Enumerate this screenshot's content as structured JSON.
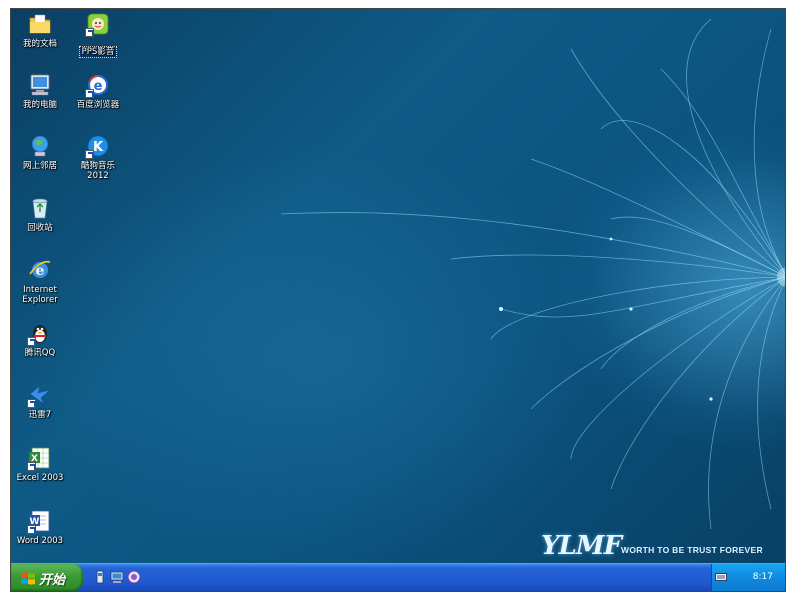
{
  "desktop": {
    "icons": [
      {
        "label": "我的文档"
      },
      {
        "label": "PPS影音"
      },
      {
        "label": "我的电脑"
      },
      {
        "label": "百度浏览器"
      },
      {
        "label": "网上邻居"
      },
      {
        "label": "酷狗音乐\n2012"
      },
      {
        "label": "回收站"
      },
      {
        "label": "Internet\nExplorer"
      },
      {
        "label": "腾讯QQ"
      },
      {
        "label": "迅雷7"
      },
      {
        "label": "Excel 2003"
      },
      {
        "label": "Word 2003"
      }
    ],
    "wallpaper": {
      "logo_text": "YLMF",
      "tagline": "WORTH TO BE TRUST FOREVER",
      "accent_color": "#8fdcff"
    }
  },
  "taskbar": {
    "start_label": "开始",
    "clock": "8:17",
    "colors": {
      "taskbar": "#2058cf",
      "start": "#3c9a36",
      "tray": "#0f8be0"
    }
  }
}
